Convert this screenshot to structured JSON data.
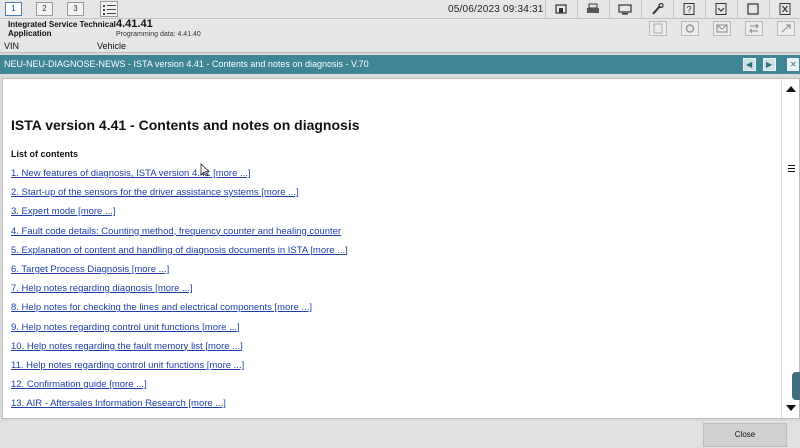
{
  "toolbar": {
    "tabs": [
      "1",
      "2",
      "3"
    ],
    "datetime": "05/06/2023 09:34:31",
    "icons": [
      "workshop-icon",
      "print-icon",
      "screen-icon",
      "wrench-icon",
      "help-icon",
      "download-icon",
      "window-icon",
      "close-icon"
    ]
  },
  "header": {
    "app_name": "Integrated Service Technical Application",
    "version": "4.41.41",
    "programming_data": "Programming data:  4.41.40",
    "vin_label": "VIN",
    "vehicle_label": "Vehicle"
  },
  "titlebar": {
    "title": "NEU-NEU-DIAGNOSE-NEWS - ISTA version 4.41 - Contents and notes on diagnosis - V.70"
  },
  "document": {
    "title": "ISTA version 4.41 - Contents and notes on diagnosis",
    "toc_heading": "List of contents",
    "items": [
      "1. New features of diagnosis, ISTA version 4.41 [more ...]",
      "2. Start-up of the sensors for the driver assistance systems [more ...]",
      "3. Expert mode [more ...]",
      "4. Fault code details: Counting method, frequency counter and healing counter",
      "5. Explanation of content and handling of diagnosis documents in ISTA [more ...]",
      "6. Target Process Diagnosis [more ...]",
      "7. Help notes regarding diagnosis [more ...]",
      "8. Help notes for checking the lines and electrical components [more ...]",
      "9. Help notes regarding control unit functions [more ...]",
      "10. Help notes regarding the fault memory list [more ...]",
      "11. Help notes regarding control unit functions [more ...]",
      "12. Confirmation guide [more ...]",
      "13. AIR - Aftersales Information Research [more ...]"
    ]
  },
  "footer": {
    "close_label": "Close"
  },
  "colors": {
    "titlebar": "#3f8497",
    "link": "#1f3fa6",
    "background": "#d9d9d9"
  }
}
